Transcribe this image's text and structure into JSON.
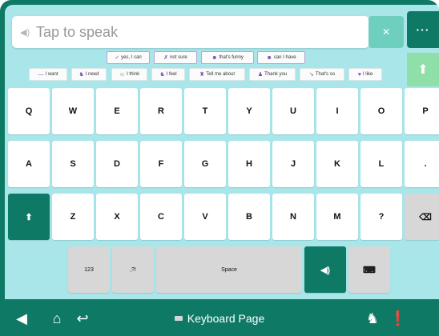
{
  "speak": {
    "placeholder": "Tap to speak",
    "icon": "speaker-icon"
  },
  "toolbar": {
    "clear_icon": "x-icon",
    "more_label": "···",
    "up_icon": "arrow-up-icon"
  },
  "phrases_row1": [
    {
      "icon": "✓",
      "label": "yes, I can"
    },
    {
      "icon": "✗",
      "label": "not sure"
    },
    {
      "icon": "☻",
      "label": "that's funny"
    },
    {
      "icon": "☻",
      "label": "can I have"
    }
  ],
  "phrases_row2": [
    {
      "icon": "—",
      "label": "I want"
    },
    {
      "icon": "♞",
      "label": "I need"
    },
    {
      "icon": "☺",
      "label": "I think"
    },
    {
      "icon": "♞",
      "label": "I feel"
    },
    {
      "icon": "♜",
      "label": "Tell me about"
    },
    {
      "icon": "♟",
      "label": "Thank you"
    },
    {
      "icon": "➘",
      "label": "That's so"
    },
    {
      "icon": "♥",
      "label": "I like"
    }
  ],
  "keys": {
    "row1": [
      "Q",
      "W",
      "E",
      "R",
      "T",
      "Y",
      "U",
      "I",
      "O",
      "P"
    ],
    "row2": [
      "A",
      "S",
      "D",
      "F",
      "G",
      "H",
      "J",
      "K",
      "L",
      "."
    ],
    "row3": [
      "Z",
      "X",
      "C",
      "V",
      "B",
      "N",
      "M",
      "?"
    ],
    "n123": "123",
    "punct": ",?!",
    "space": "Space"
  },
  "nav": {
    "title": "Keyboard Page"
  },
  "colors": {
    "teal": "#0e7a66",
    "panel": "#a8e6ea",
    "accent_light": "#6fcfbe"
  }
}
